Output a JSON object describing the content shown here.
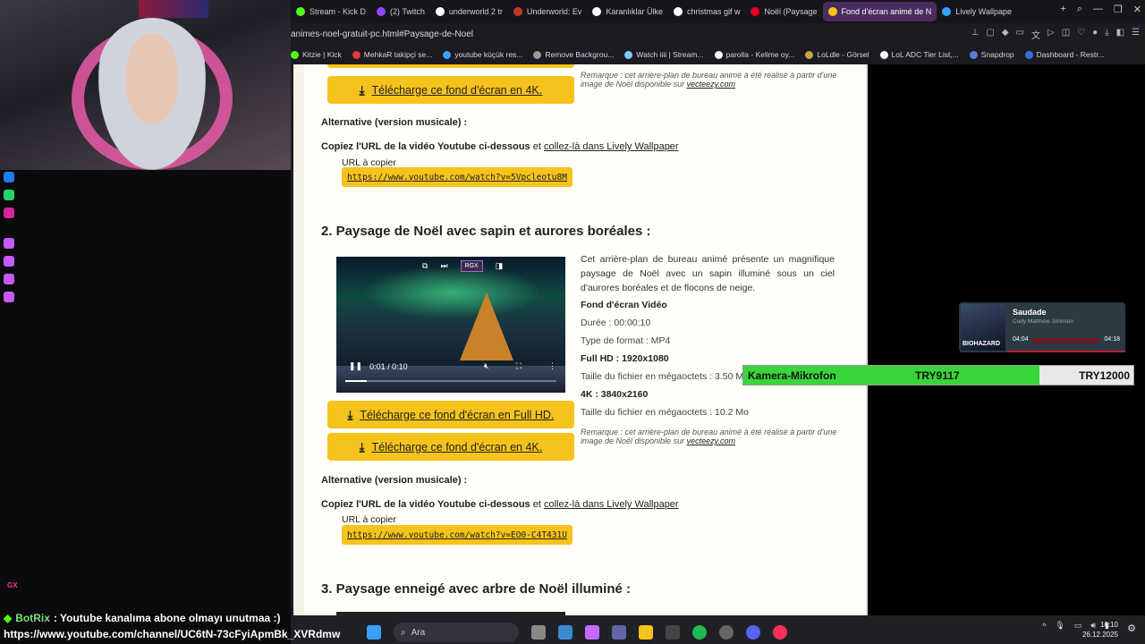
{
  "browser": {
    "tabs": [
      {
        "label": "Stream - Kick D",
        "color": "#53fc18"
      },
      {
        "label": "(2) Twitch",
        "color": "#9146ff"
      },
      {
        "label": "underworld 2 tr",
        "color": "#ffffff"
      },
      {
        "label": "Underworld: Ev",
        "color": "#c0392b"
      },
      {
        "label": "Karanlıklar Ülke",
        "color": "#ffffff"
      },
      {
        "label": "christmas gif w",
        "color": "#ffffff"
      },
      {
        "label": "Noël (Paysage",
        "color": "#e60023"
      },
      {
        "label": "Fond d'écran animé de N",
        "color": "#f5c31b"
      },
      {
        "label": "Lively Wallpape",
        "color": "#3aa0ff"
      }
    ],
    "url": "animes-noel-gratuit-pc.html#Paysage-de-Noel",
    "bookmarks": [
      {
        "label": "Kitzie | Kick",
        "color": "#53fc18"
      },
      {
        "label": "MehkaR takipçi se...",
        "color": "#e53935"
      },
      {
        "label": "youtube küçük res...",
        "color": "#3aa0ff"
      },
      {
        "label": "Remove Backgrou...",
        "color": "#999999"
      },
      {
        "label": "Watch iiii | Stream...",
        "color": "#7ec8ff"
      },
      {
        "label": "parolla - Kelime oy...",
        "color": "#ffffff"
      },
      {
        "label": "LoLdle - Görsel",
        "color": "#caa14a"
      },
      {
        "label": "LoL ADC Tier List,...",
        "color": "#ffffff"
      },
      {
        "label": "Snapdrop",
        "color": "#5a7bd6"
      },
      {
        "label": "Dashboard - Restr...",
        "color": "#3a6fd6"
      }
    ]
  },
  "page": {
    "btn_4k": "Télécharge ce fond d'écran en 4K.",
    "btn_fullhd": "Télécharge ce fond d'écran en Full HD.",
    "remark_prefix": "Remarque : cet arrière-plan de bureau animé à été réalisé à partir d'une image de Noël disponible sur",
    "remark_link": "vecteezy.com",
    "alt_heading": "Alternative (version musicale) :",
    "copy_text_bold": "Copiez l'URL de la vidéo Youtube ci-dessous",
    "copy_text_et": "et",
    "copy_link": "collez-là dans Lively Wallpaper",
    "url_label": "URL à copier",
    "url1": "https://www.youtube.com/watch?v=5Vpcleotu8M",
    "url2": "https://www.youtube.com/watch?v=EO0-C4T431U",
    "section2_title": "2. Paysage de Noël avec sapin et aurores boréales :",
    "section3_title": "3. Paysage enneigé avec arbre de Noël illuminé :",
    "description": "Cet arrière-plan de bureau animé présente un magnifique paysage de Noël avec un sapin illuminé sous un ciel d'aurores boréales et de flocons de neige.",
    "fond_title": "Fond d'écran Vidéo",
    "duration": "Durée : 00:00:10",
    "format": "Type de format : MP4",
    "fullhd": "Full HD : 1920x1080",
    "size_fullhd": "Taille du fichier en mégaoctets : 3.50 M",
    "fourk": "4K : 3840x2160",
    "size_4k": "Taille du fichier en mégaoctets : 10.2 Mo",
    "video_time": "0:01 / 0:10",
    "video_progress": 0.1,
    "rgx_label": "RGX"
  },
  "overlay": {
    "song_title": "Saudade",
    "song_artist": "Cody Matthew Johnson",
    "song_time_current": "04:04",
    "song_time_total": "04:18",
    "album_text": "BIOHAZARD",
    "goal_label": "Kamera-Mikrofon",
    "goal_current": "TRY9117",
    "goal_target": "TRY12000",
    "goal_fraction": 0.76,
    "chat_name": "BotRix",
    "chat_message": ": Youtube kanalıma abone olmayı unutmaa :)",
    "chat_url": "https://www.youtube.com/channel/UC6tN-73cFyiApmBk_XVRdmw",
    "gx_label": "GX"
  },
  "taskbar": {
    "search_placeholder": "Ara",
    "time": "16:10",
    "date": "26.12.2025"
  }
}
